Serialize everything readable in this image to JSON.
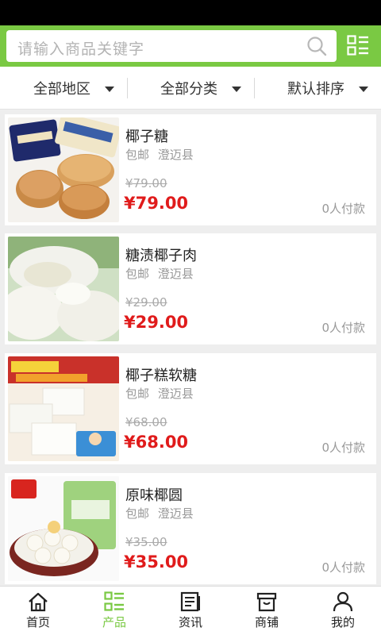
{
  "search": {
    "placeholder": "请输入商品关键字"
  },
  "filters": [
    {
      "label": "全部地区"
    },
    {
      "label": "全部分类"
    },
    {
      "label": "默认排序"
    }
  ],
  "products": [
    {
      "title": "椰子糖",
      "shipping": "包邮",
      "location": "澄迈县",
      "old_price": "¥79.00",
      "price": "¥79.00",
      "sold": "0人付款"
    },
    {
      "title": "糖渍椰子肉",
      "shipping": "包邮",
      "location": "澄迈县",
      "old_price": "¥29.00",
      "price": "¥29.00",
      "sold": "0人付款"
    },
    {
      "title": "椰子糕软糖",
      "shipping": "包邮",
      "location": "澄迈县",
      "old_price": "¥68.00",
      "price": "¥68.00",
      "sold": "0人付款"
    },
    {
      "title": "原味椰圆",
      "shipping": "包邮",
      "location": "澄迈县",
      "old_price": "¥35.00",
      "price": "¥35.00",
      "sold": "0人付款"
    }
  ],
  "tabs": [
    {
      "label": "首页",
      "icon": "home-icon",
      "active": false
    },
    {
      "label": "产品",
      "icon": "product-list-icon",
      "active": true
    },
    {
      "label": "资讯",
      "icon": "news-icon",
      "active": false
    },
    {
      "label": "商铺",
      "icon": "store-icon",
      "active": false
    },
    {
      "label": "我的",
      "icon": "user-icon",
      "active": false
    }
  ],
  "colors": {
    "accent": "#7ac943",
    "price": "#e01b1b",
    "status_bar": "#000000"
  }
}
